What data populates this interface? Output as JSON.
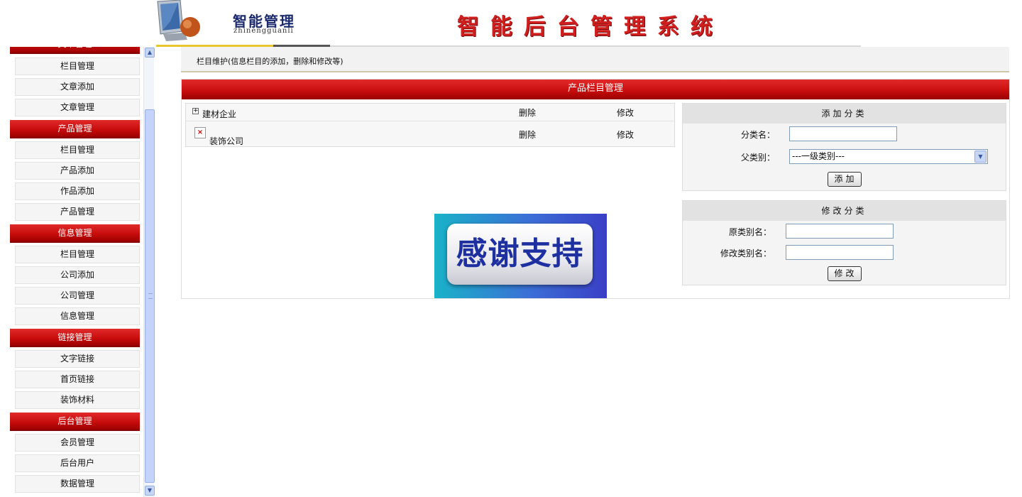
{
  "header": {
    "logo_cn": "智能管理",
    "logo_en": "zhinengguanli",
    "system_title": "智能后台管理系统"
  },
  "sidebar": {
    "groups": [
      {
        "title": "文章管理",
        "items": [
          "栏目管理",
          "文章添加",
          "文章管理"
        ]
      },
      {
        "title": "产品管理",
        "items": [
          "栏目管理",
          "产品添加",
          "作品添加",
          "产品管理"
        ]
      },
      {
        "title": "信息管理",
        "items": [
          "栏目管理",
          "公司添加",
          "公司管理",
          "信息管理"
        ]
      },
      {
        "title": "链接管理",
        "items": [
          "文字链接",
          "首页链接",
          "装饰材料"
        ]
      },
      {
        "title": "后台管理",
        "items": [
          "会员管理",
          "后台用户",
          "数据管理"
        ]
      }
    ]
  },
  "breadcrumb": "栏目维护(信息栏目的添加，删除和修改等)",
  "panel": {
    "title": "产品栏目管理",
    "tree": [
      {
        "name": "建材企业",
        "delete": "删除",
        "edit": "修改",
        "icon": "plus-icon"
      },
      {
        "name": "装饰公司",
        "delete": "删除",
        "edit": "修改",
        "icon": "broken-image-icon"
      }
    ],
    "banner_text": "感谢支持"
  },
  "add_form": {
    "title": "添加分类",
    "name_label": "分类名：",
    "name_value": "",
    "parent_label": "父类别：",
    "parent_selected": "---一级类别---",
    "submit": "添加"
  },
  "edit_form": {
    "title": "修改分类",
    "old_label": "原类别名：",
    "old_value": "",
    "new_label": "修改类别名：",
    "new_value": "",
    "submit": "修改"
  }
}
